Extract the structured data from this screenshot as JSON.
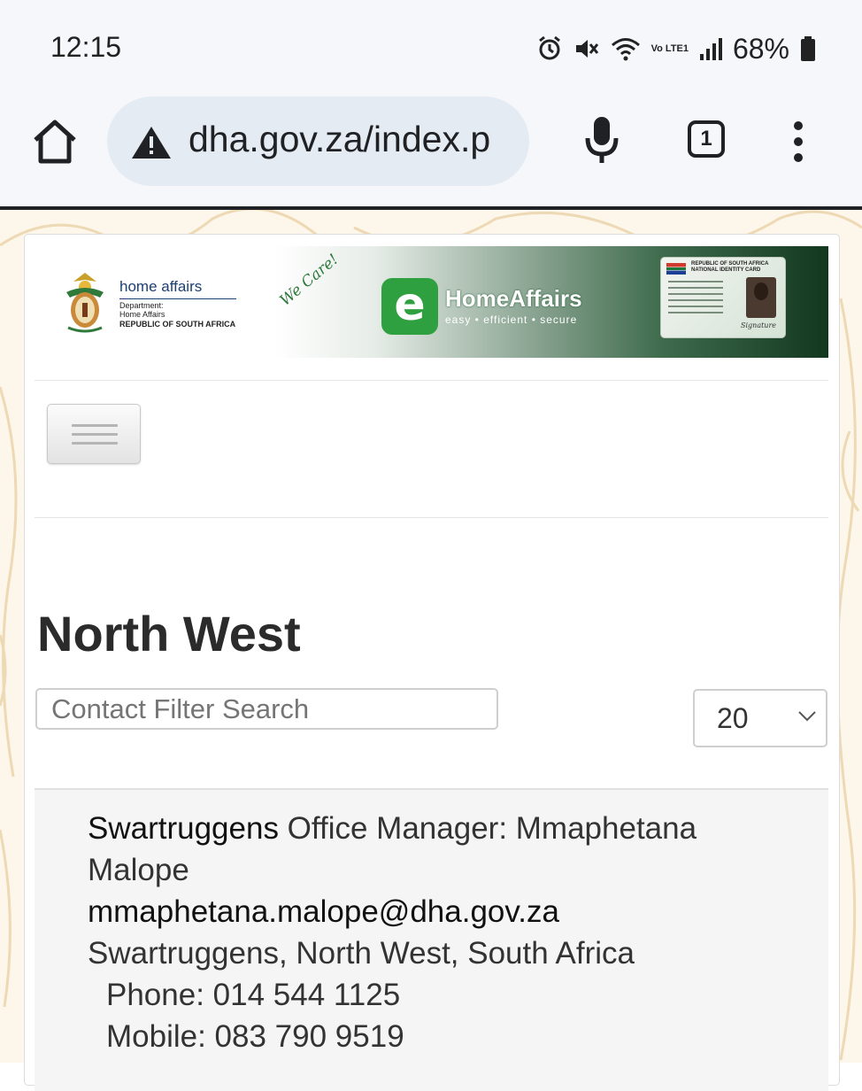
{
  "status_bar": {
    "time": "12:15",
    "network": "Vo LTE1",
    "battery": "68%",
    "icons": [
      "alarm-icon",
      "mute-icon",
      "wifi-icon",
      "volte-icon",
      "signal-icon",
      "battery-icon"
    ]
  },
  "browser": {
    "url": "dha.gov.za/index.p",
    "tab_count": "1",
    "icons": [
      "home-icon",
      "warning-icon",
      "mic-icon",
      "tabs-icon",
      "more-vert-icon"
    ]
  },
  "header": {
    "org_title": "home affairs",
    "org_dept_line1": "Department:",
    "org_dept_line2": "Home Affairs",
    "org_country": "REPUBLIC OF SOUTH AFRICA",
    "slogan": "We Care!",
    "brand_letter": "e",
    "brand_name": "HomeAffairs",
    "brand_tagline": "easy • efficient • secure",
    "id_card_title_1": "REPUBLIC OF SOUTH AFRICA",
    "id_card_title_2": "NATIONAL IDENTITY CARD",
    "id_card_signature": "Signature"
  },
  "page": {
    "title": "North West",
    "search_placeholder": "Contact Filter Search",
    "per_page_value": "20"
  },
  "contacts": [
    {
      "office": "Swartruggens",
      "position_name_line1": " Office Manager: Mmaphetana",
      "position_name_line2": "Malope",
      "email": "mmaphetana.malope@dha.gov.za",
      "address": "Swartruggens, North West, South Africa",
      "phone": "Phone: 014 544 1125",
      "mobile": "Mobile: 083 790 9519"
    }
  ],
  "colors": {
    "accent_green": "#2fa040",
    "banner_dark": "#12381f",
    "title_text": "#2b2b2b",
    "page_bg": "#fdf6ea"
  }
}
